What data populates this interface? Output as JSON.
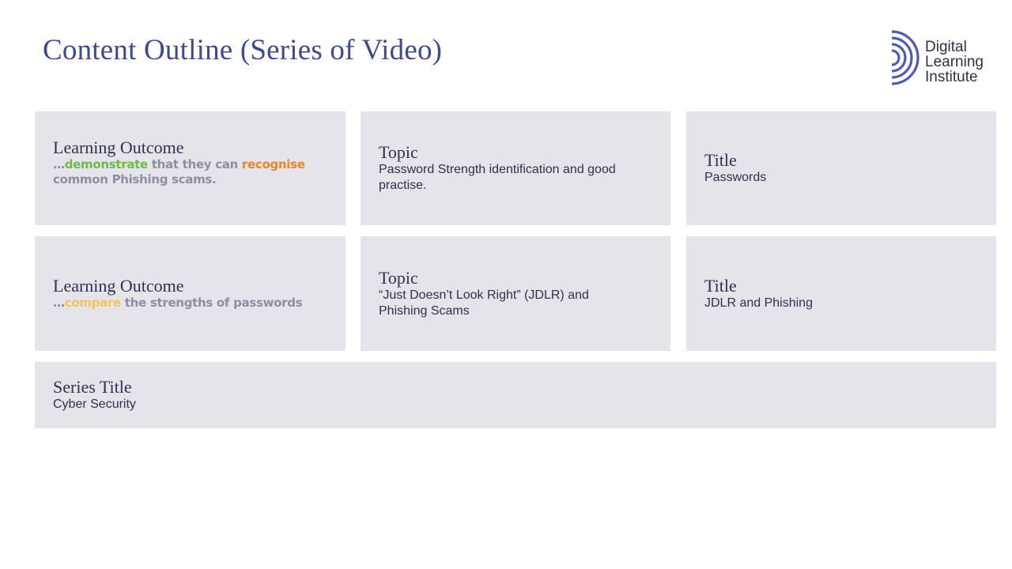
{
  "slide": {
    "title": "Content Outline (Series of Video)"
  },
  "logo": {
    "line1": "Digital",
    "line2": "Learning",
    "line3": "Institute",
    "icon": "concentric-arcs-icon"
  },
  "colors": {
    "title": "#3f4a8c",
    "card_bg": "#e5e4ea",
    "logo_blue": "#4f5cb0",
    "highlight_green": "#6cbb4a",
    "highlight_orange": "#ec8326",
    "highlight_yellow": "#f6c55a",
    "outcome_grey": "#8e8fa0"
  },
  "row1": {
    "outcome": {
      "heading": "Learning Outcome",
      "prefix": "…",
      "highlight1": "demonstrate",
      "middle": " that they can ",
      "highlight2": "recognise",
      "suffix": " common Phishing scams."
    },
    "topic": {
      "heading": "Topic",
      "body": "Password Strength identification and good practise."
    },
    "title": {
      "heading": "Title",
      "body": "Passwords"
    }
  },
  "row2": {
    "outcome": {
      "heading": "Learning Outcome",
      "prefix": "…",
      "highlight1": "compare",
      "suffix": " the strengths of passwords"
    },
    "topic": {
      "heading": "Topic",
      "body": "“Just Doesn’t Look Right” (JDLR) and Phishing Scams"
    },
    "title": {
      "heading": "Title",
      "body": "JDLR and Phishing"
    }
  },
  "series": {
    "heading": "Series Title",
    "body": "Cyber Security"
  }
}
